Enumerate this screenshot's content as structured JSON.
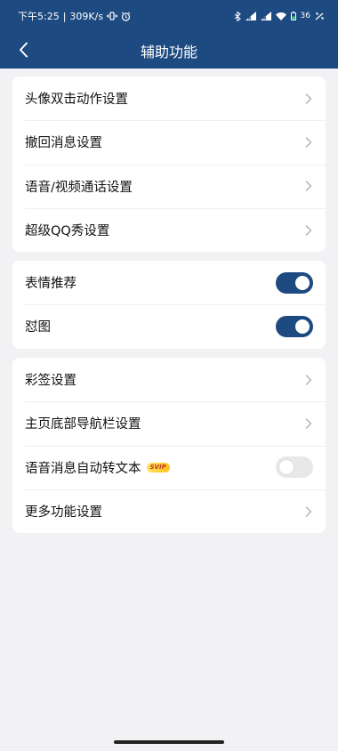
{
  "status_bar": {
    "time": "下午5:25",
    "network_speed": "309K/s",
    "battery": "36"
  },
  "header": {
    "title": "辅助功能"
  },
  "sections": [
    {
      "rows": [
        {
          "label": "头像双击动作设置",
          "control": "chevron"
        },
        {
          "label": "撤回消息设置",
          "control": "chevron"
        },
        {
          "label": "语音/视频通话设置",
          "control": "chevron"
        },
        {
          "label": "超级QQ秀设置",
          "control": "chevron"
        }
      ]
    },
    {
      "rows": [
        {
          "label": "表情推荐",
          "control": "toggle",
          "on": true
        },
        {
          "label": "怼图",
          "control": "toggle",
          "on": true
        }
      ]
    },
    {
      "rows": [
        {
          "label": "彩签设置",
          "control": "chevron"
        },
        {
          "label": "主页底部导航栏设置",
          "control": "chevron"
        },
        {
          "label": "语音消息自动转文本",
          "badge": "SVIP",
          "control": "toggle",
          "on": false
        },
        {
          "label": "更多功能设置",
          "control": "chevron"
        }
      ]
    }
  ],
  "colors": {
    "header_bg": "#1d4a80",
    "toggle_on": "#1d4a80",
    "page_bg": "#f2f2f4"
  }
}
